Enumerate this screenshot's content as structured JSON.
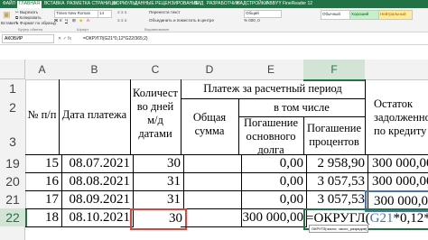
{
  "ribbon": {
    "tabs": [
      "ФАЙЛ",
      "ГЛАВНАЯ",
      "ВСТАВКА",
      "РАЗМЕТКА СТРАНИЦЫ",
      "ФОРМУЛЫ",
      "ДАННЫЕ",
      "РЕЦЕНЗИРОВАНИЕ",
      "ВИД",
      "РАЗРАБОТЧИК",
      "НАДСТРОЙКИ",
      "ABBYY FineReader 12"
    ],
    "clipboard": [
      "Вырезать",
      "Копировать",
      "Формат по образцу"
    ],
    "paste_label": "Вставить",
    "font_name": "Times New Roman",
    "font_size": "14",
    "wrap_text": "Перенести текст",
    "merge": "Объединить и поместить в центре",
    "number_format": "Общий",
    "styles": [
      "Обычный",
      "Хороший",
      "Нейтральный"
    ],
    "group_clipboard": "Буфер обмена",
    "group_font": "Шрифт",
    "group_align": "Выравнивание"
  },
  "formula_bar": {
    "name_box": "АКОБИР",
    "formula": "=ОКРУГЛ(G21*0,12*G22/365;2)"
  },
  "columns": [
    "A",
    "B",
    "C",
    "D",
    "E",
    "F"
  ],
  "rows": [
    "1",
    "2",
    "3",
    "19",
    "20",
    "21",
    "22"
  ],
  "headers": {
    "num": "№ п/п",
    "date": "Дата платежа",
    "days": "Количест во дней м/д датами",
    "period": "Платеж за расчетный период",
    "total": "Общая сумма",
    "incl": "в том числе",
    "principal": "Погашение основного долга",
    "interest": "Погашение процентов",
    "balance": "Остаток задолженности по кредиту"
  },
  "data_rows": [
    {
      "num": "15",
      "date": "08.07.2021",
      "days": "30",
      "principal": "0,00",
      "interest": "2 958,90",
      "balance": "300 000,00"
    },
    {
      "num": "16",
      "date": "08.08.2021",
      "days": "31",
      "principal": "0,00",
      "interest": "3 057,53",
      "balance": "300 000,00"
    },
    {
      "num": "17",
      "date": "08.09.2021",
      "days": "31",
      "principal": "0,00",
      "interest": "3 057,53",
      "balance": "300 000,00"
    },
    {
      "num": "18",
      "date": "08.10.2021",
      "days": "30",
      "principal": "300 000,00",
      "interest": "",
      "balance": ""
    }
  ],
  "editing": {
    "prefix": "=ОКРУГЛ(",
    "ref": "G21",
    "suffix": "*0,12*"
  },
  "tooltip": "ОКРУГЛ(число; число_разрядов)",
  "colors": {
    "accent": "#217346",
    "ref_blue": "#4472c4",
    "ref_red": "#e0423a"
  }
}
